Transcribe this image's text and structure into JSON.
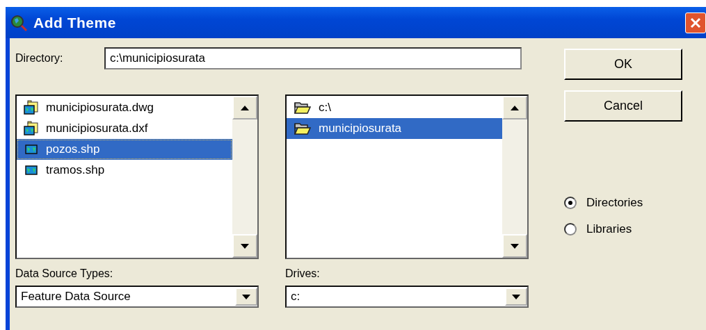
{
  "window": {
    "title": "Add Theme"
  },
  "directory": {
    "label": "Directory:",
    "value": "c:\\municipiosurata"
  },
  "files": [
    {
      "name": "municipiosurata.dwg",
      "kind": "cad",
      "selected": false,
      "focused": false
    },
    {
      "name": "municipiosurata.dxf",
      "kind": "cad",
      "selected": false,
      "focused": false
    },
    {
      "name": "pozos.shp",
      "kind": "shapefile",
      "selected": true,
      "focused": true
    },
    {
      "name": "tramos.shp",
      "kind": "shapefile",
      "selected": false,
      "focused": false
    }
  ],
  "folders": [
    {
      "name": "c:\\",
      "selected": false
    },
    {
      "name": "municipiosurata",
      "selected": true
    }
  ],
  "buttons": [
    "OK",
    "Cancel"
  ],
  "source_mode": [
    {
      "label": "Directories",
      "selected": true
    },
    {
      "label": "Libraries",
      "selected": false
    }
  ],
  "data_source_types": {
    "label": "Data Source Types:",
    "value": "Feature Data Source"
  },
  "drives": {
    "label": "Drives:",
    "value": "c:"
  }
}
